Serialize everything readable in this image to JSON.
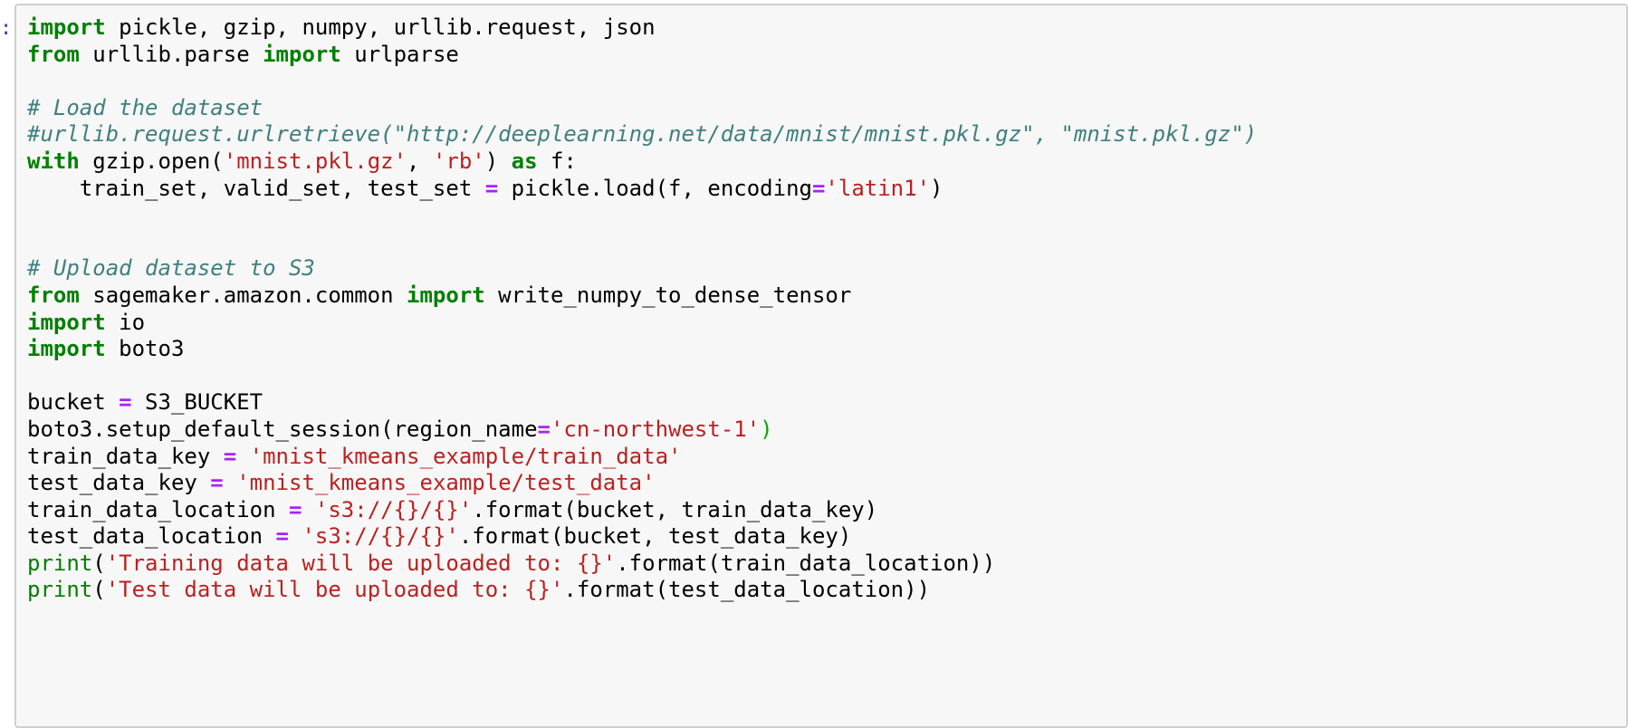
{
  "prompt": {
    "marker": ":"
  },
  "colors": {
    "cell_background": "#f7f7f7",
    "cell_border": "#cfcfcf",
    "keyword": "#008000",
    "comment": "#408080",
    "string": "#ba2121",
    "operator": "#aa22ff",
    "builtin": "#008000",
    "bracket_match": "#00aa00"
  },
  "code_cell": {
    "lines": [
      [
        {
          "t": "kw",
          "v": "import"
        },
        {
          "t": "tx",
          "v": " pickle, gzip, numpy, urllib.request, json"
        }
      ],
      [
        {
          "t": "kw",
          "v": "from"
        },
        {
          "t": "tx",
          "v": " urllib.parse "
        },
        {
          "t": "kw",
          "v": "import"
        },
        {
          "t": "tx",
          "v": " urlparse"
        }
      ],
      [],
      [
        {
          "t": "cm",
          "v": "# Load the dataset"
        }
      ],
      [
        {
          "t": "cm",
          "v": "#urllib.request.urlretrieve(\"http://deeplearning.net/data/mnist/mnist.pkl.gz\", \"mnist.pkl.gz\")"
        }
      ],
      [
        {
          "t": "kw",
          "v": "with"
        },
        {
          "t": "tx",
          "v": " gzip.open("
        },
        {
          "t": "st",
          "v": "'mnist.pkl.gz'"
        },
        {
          "t": "tx",
          "v": ", "
        },
        {
          "t": "st",
          "v": "'rb'"
        },
        {
          "t": "tx",
          "v": ") "
        },
        {
          "t": "kw",
          "v": "as"
        },
        {
          "t": "tx",
          "v": " f:"
        }
      ],
      [
        {
          "t": "tx",
          "v": "    train_set, valid_set, test_set "
        },
        {
          "t": "op",
          "v": "="
        },
        {
          "t": "tx",
          "v": " pickle.load(f, encoding"
        },
        {
          "t": "op",
          "v": "="
        },
        {
          "t": "st",
          "v": "'latin1'"
        },
        {
          "t": "tx",
          "v": ")"
        }
      ],
      [],
      [],
      [
        {
          "t": "cm",
          "v": "# Upload dataset to S3"
        }
      ],
      [
        {
          "t": "kw",
          "v": "from"
        },
        {
          "t": "tx",
          "v": " sagemaker.amazon.common "
        },
        {
          "t": "kw",
          "v": "import"
        },
        {
          "t": "tx",
          "v": " write_numpy_to_dense_tensor"
        }
      ],
      [
        {
          "t": "kw",
          "v": "import"
        },
        {
          "t": "tx",
          "v": " io"
        }
      ],
      [
        {
          "t": "kw",
          "v": "import"
        },
        {
          "t": "tx",
          "v": " boto3"
        }
      ],
      [],
      [
        {
          "t": "tx",
          "v": "bucket "
        },
        {
          "t": "op",
          "v": "="
        },
        {
          "t": "tx",
          "v": " S3_BUCKET"
        }
      ],
      [
        {
          "t": "tx",
          "v": "boto3.setup_default_session(region_name"
        },
        {
          "t": "op",
          "v": "="
        },
        {
          "t": "st",
          "v": "'cn-northwest-1'"
        },
        {
          "t": "hl",
          "v": ")"
        }
      ],
      [
        {
          "t": "tx",
          "v": "train_data_key "
        },
        {
          "t": "op",
          "v": "="
        },
        {
          "t": "tx",
          "v": " "
        },
        {
          "t": "st",
          "v": "'mnist_kmeans_example/train_data'"
        }
      ],
      [
        {
          "t": "tx",
          "v": "test_data_key "
        },
        {
          "t": "op",
          "v": "="
        },
        {
          "t": "tx",
          "v": " "
        },
        {
          "t": "st",
          "v": "'mnist_kmeans_example/test_data'"
        }
      ],
      [
        {
          "t": "tx",
          "v": "train_data_location "
        },
        {
          "t": "op",
          "v": "="
        },
        {
          "t": "tx",
          "v": " "
        },
        {
          "t": "st",
          "v": "'s3://{}/{}'"
        },
        {
          "t": "tx",
          "v": ".format(bucket, train_data_key)"
        }
      ],
      [
        {
          "t": "tx",
          "v": "test_data_location "
        },
        {
          "t": "op",
          "v": "="
        },
        {
          "t": "tx",
          "v": " "
        },
        {
          "t": "st",
          "v": "'s3://{}/{}'"
        },
        {
          "t": "tx",
          "v": ".format(bucket, test_data_key)"
        }
      ],
      [
        {
          "t": "bi",
          "v": "print"
        },
        {
          "t": "tx",
          "v": "("
        },
        {
          "t": "st",
          "v": "'Training data will be uploaded to: {}'"
        },
        {
          "t": "tx",
          "v": ".format(train_data_location))"
        }
      ],
      [
        {
          "t": "bi",
          "v": "print"
        },
        {
          "t": "tx",
          "v": "("
        },
        {
          "t": "st",
          "v": "'Test data will be uploaded to: {}'"
        },
        {
          "t": "tx",
          "v": ".format(test_data_location))"
        }
      ]
    ]
  }
}
